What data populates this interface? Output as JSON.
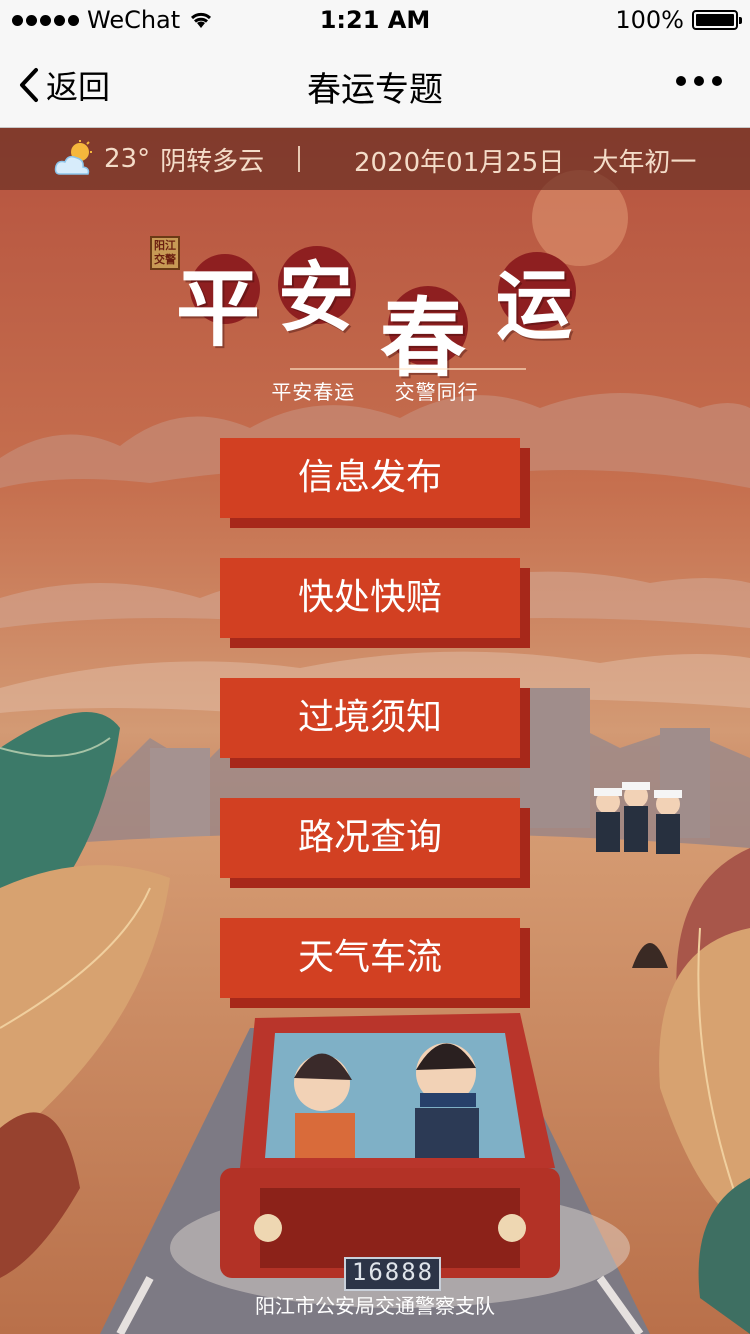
{
  "status_bar": {
    "carrier": "WeChat",
    "time": "1:21 AM",
    "battery": "100%"
  },
  "nav": {
    "back_label": "返回",
    "title": "春运专题"
  },
  "weather": {
    "temperature": "23°",
    "condition": "阴转多云",
    "date": "2020年01月25日",
    "lunar_day": "大年初一"
  },
  "logo": {
    "seal_line1": "阳江",
    "seal_line2": "交警",
    "title_chars": [
      "平",
      "安",
      "春",
      "运"
    ]
  },
  "tagline": {
    "left": "平安春运",
    "right": "交警同行"
  },
  "menu": {
    "items": [
      {
        "label": "信息发布"
      },
      {
        "label": "快处快赔"
      },
      {
        "label": "过境须知"
      },
      {
        "label": "路况查询"
      },
      {
        "label": "天气车流"
      }
    ]
  },
  "car": {
    "plate": "16888"
  },
  "footer": {
    "org": "阳江市公安局交通警察支队"
  },
  "colors": {
    "button": "#d24022",
    "button_shadow": "#a7281a",
    "calligraphy_disc": "#8e1f20"
  }
}
